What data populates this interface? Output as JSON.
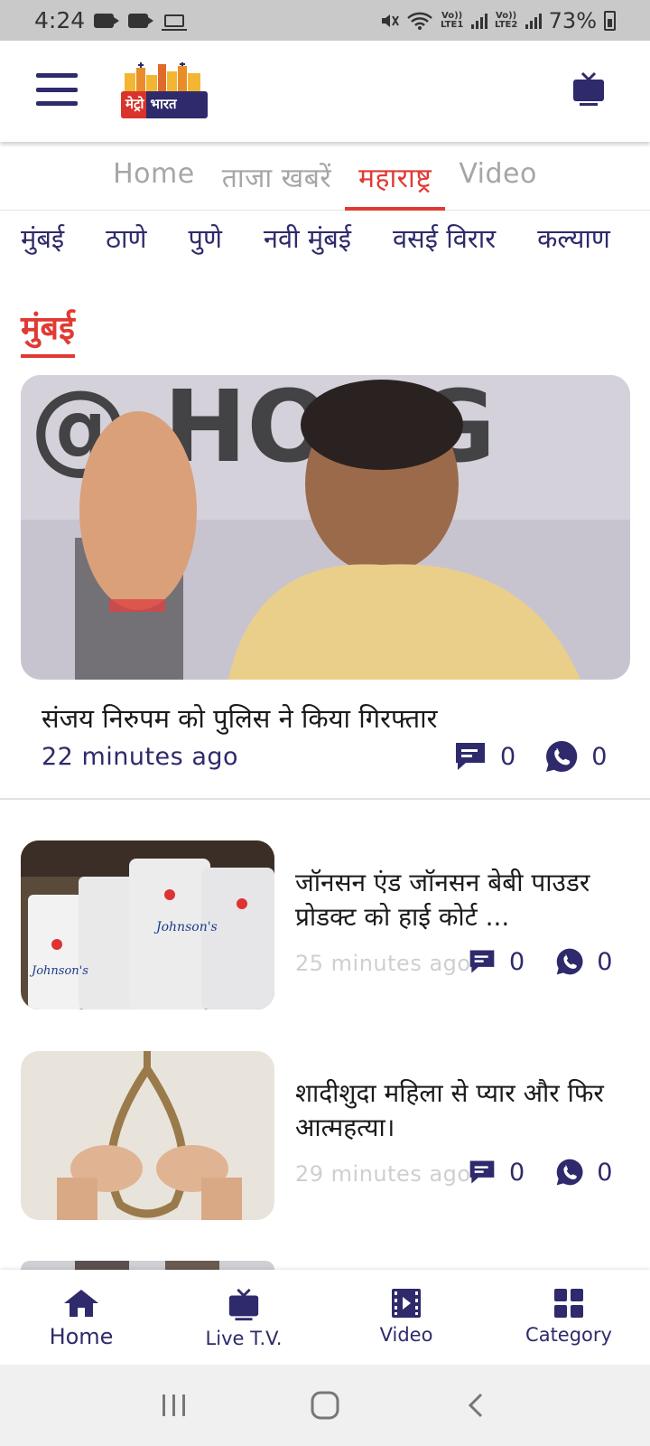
{
  "status_bar": {
    "time": "4:24",
    "battery": "73%",
    "sim1": "Vo)) LTE1",
    "sim2": "Vo)) LTE2"
  },
  "header": {
    "logo_text_left": "मेट्रो",
    "logo_text_right": "भारत"
  },
  "tabs": [
    {
      "label": "Home",
      "active": false
    },
    {
      "label": "ताजा खबरें",
      "active": false
    },
    {
      "label": "महाराष्ट्र",
      "active": true
    },
    {
      "label": "Video",
      "active": false
    }
  ],
  "subtabs": [
    "मुंबई",
    "ठाणे",
    "पुणे",
    "नवी मुंबई",
    "वसई विरार",
    "कल्याण"
  ],
  "section": {
    "title": "मुंबई"
  },
  "featured": {
    "title": "संजय निरुपम को पुलिस ने किया गिरफ्तार",
    "time": "22 minutes ago",
    "comments": "0",
    "shares": "0"
  },
  "articles": [
    {
      "title": "जॉनसन एंड जॉनसन बेबी पाउडर प्रोडक्ट को हाई कोर्ट ...",
      "time": "25 minutes ago",
      "comments": "0",
      "shares": "0"
    },
    {
      "title": "शादीशुदा महिला से प्यार और फिर आत्महत्या।",
      "time": "29 minutes ago",
      "comments": "0",
      "shares": "0"
    }
  ],
  "bottom_nav": [
    {
      "label": "Home",
      "icon": "home-icon"
    },
    {
      "label": "Live T.V.",
      "icon": "tv-icon"
    },
    {
      "label": "Video",
      "icon": "video-icon"
    },
    {
      "label": "Category",
      "icon": "grid-icon"
    }
  ],
  "colors": {
    "brand_navy": "#2e2a6b",
    "accent_red": "#e03a33",
    "muted": "#a6a6a6"
  }
}
